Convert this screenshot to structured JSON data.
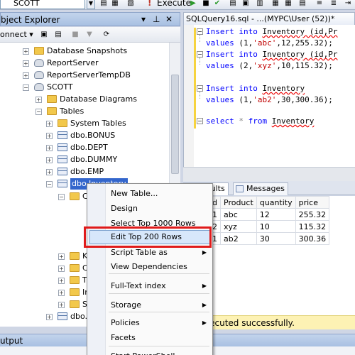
{
  "toolbar": {
    "database": "SCOTT",
    "execute_label": "Execute"
  },
  "object_explorer": {
    "title": "bject Explorer",
    "pin_glyph": "▾ ⊥ ✕",
    "connect_label": "onnect ▾",
    "tree": [
      {
        "label": "Database Snapshots",
        "icon": "folder-icon",
        "expander": "+"
      },
      {
        "label": "ReportServer",
        "icon": "database-icon",
        "expander": "+"
      },
      {
        "label": "ReportServerTempDB",
        "icon": "database-icon",
        "expander": "+"
      },
      {
        "label": "SCOTT",
        "icon": "database-icon",
        "expander": "−"
      },
      {
        "label": "Database Diagrams",
        "icon": "folder-icon",
        "expander": "+"
      },
      {
        "label": "Tables",
        "icon": "folder-icon",
        "expander": "−"
      },
      {
        "label": "System Tables",
        "icon": "folder-icon",
        "expander": "+"
      },
      {
        "label": "dbo.BONUS",
        "icon": "table-icon",
        "expander": "+"
      },
      {
        "label": "dbo.DEPT",
        "icon": "table-icon",
        "expander": "+"
      },
      {
        "label": "dbo.DUMMY",
        "icon": "table-icon",
        "expander": "+"
      },
      {
        "label": "dbo.EMP",
        "icon": "table-icon",
        "expander": "+"
      },
      {
        "label": "dbo.Inventory",
        "icon": "table-icon",
        "expander": "−"
      },
      {
        "label": "C",
        "icon": "folder-icon",
        "expander": "−"
      },
      {
        "label": "K",
        "icon": "folder-icon",
        "expander": "+"
      },
      {
        "label": "C",
        "icon": "folder-icon",
        "expander": "+"
      },
      {
        "label": "T",
        "icon": "folder-icon",
        "expander": "+"
      },
      {
        "label": "In",
        "icon": "folder-icon",
        "expander": "+"
      },
      {
        "label": "S",
        "icon": "folder-icon",
        "expander": "+"
      },
      {
        "label": "dbo.",
        "icon": "table-icon",
        "expander": "+"
      }
    ]
  },
  "editor": {
    "tab_title": "SQLQuery16.sql - ...(MYPC\\User (52))*",
    "lines": [
      {
        "kw": "Insert into ",
        "text": "Inventory (id,Pr",
        "sq": true
      },
      {
        "kw": "values ",
        "text": "(1,",
        "str": "'abc'",
        "rest": ",12,255.32);"
      },
      {
        "kw": "Insert into ",
        "text": "Inventory (id,Pr",
        "sq": true
      },
      {
        "kw": "values ",
        "text": "(2,",
        "str": "'xyz'",
        "rest": ",10,115.32);"
      },
      {
        "kw": "Insert into ",
        "text": "Inventory",
        "sq": true
      },
      {
        "kw": "values ",
        "text": "(1,",
        "str": "'ab2'",
        "rest": ",30,300.36);"
      },
      {
        "kw": "select ",
        "gr": "* ",
        "kw2": "from ",
        "text": "Inventory",
        "sq": true
      }
    ]
  },
  "results": {
    "tab_results": "Results",
    "tab_messages": "Messages",
    "columns": [
      "d",
      "Product",
      "quantity",
      "price"
    ],
    "rows": [
      [
        "1",
        "abc",
        "12",
        "255.32"
      ],
      [
        "2",
        "xyz",
        "10",
        "115.32"
      ],
      [
        "1",
        "ab2",
        "30",
        "300.36"
      ]
    ],
    "status": "ery executed successfully."
  },
  "output": {
    "title": "utput"
  },
  "context_menu": {
    "items": [
      "New Table...",
      "Design",
      "Select Top 1000 Rows",
      "Edit Top 200 Rows",
      "Script Table as",
      "View Dependencies",
      "Full-Text index",
      "Storage",
      "Policies",
      "Facets",
      "Start PowerShell"
    ],
    "highlighted": "Edit Top 200 Rows"
  }
}
